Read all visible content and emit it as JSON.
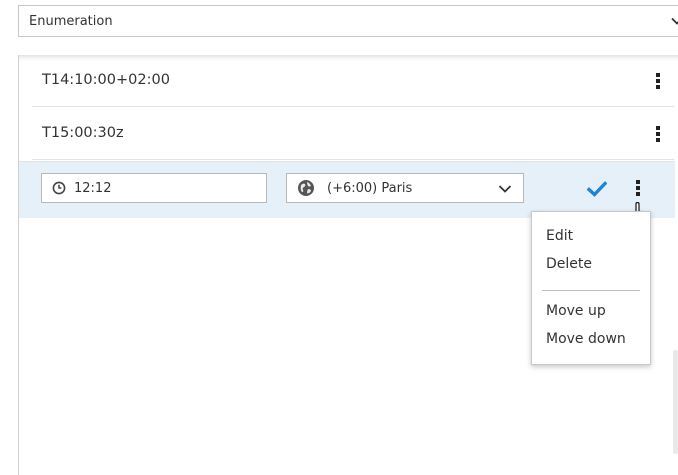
{
  "field": {
    "label": "Enumeration"
  },
  "list": {
    "items": [
      {
        "text": "T14:10:00+02:00"
      },
      {
        "text": "T15:00:30z"
      }
    ]
  },
  "edit_row": {
    "time_value": "12:12",
    "timezone_value": "(+6:00) Paris"
  },
  "menu": {
    "edit": "Edit",
    "delete": "Delete",
    "move_up": "Move up",
    "move_down": "Move down"
  },
  "colors": {
    "accent": "#1b86d6",
    "edit_row_bg": "#e6f0f9"
  },
  "icons": {
    "clock": "clock-icon",
    "globe": "globe-icon",
    "check": "checkmark-icon",
    "kebab": "kebab-menu-icon",
    "chevron": "chevron-down-icon",
    "cursor": "hand-pointer-icon"
  }
}
